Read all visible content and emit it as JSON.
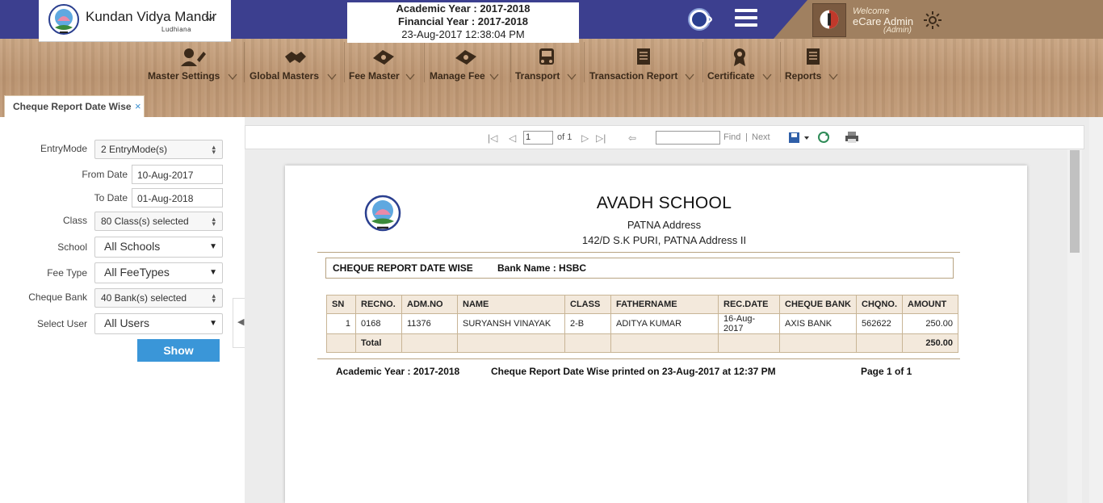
{
  "header": {
    "school_name": "Kundan Vidya Mandir",
    "school_city": "Ludhiana",
    "academic_year": "Academic Year : 2017-2018",
    "financial_year": "Financial Year : 2017-2018",
    "datetime": "23-Aug-2017 12:38:04 PM",
    "welcome": "Welcome",
    "user_name": "eCare Admin",
    "user_role": "(Admin)",
    "colors": {
      "topbar": "#3c3f8f",
      "accent": "#3a96d8"
    }
  },
  "menu": [
    {
      "label": "Master Settings",
      "icon": "user-edit-icon"
    },
    {
      "label": "Global Masters",
      "icon": "handshake-icon"
    },
    {
      "label": "Fee Master",
      "icon": "money-icon"
    },
    {
      "label": "Manage Fee",
      "icon": "money-icon"
    },
    {
      "label": "Transport",
      "icon": "bus-icon"
    },
    {
      "label": "Transaction Report",
      "icon": "document-icon"
    },
    {
      "label": "Certificate",
      "icon": "award-icon"
    },
    {
      "label": "Reports",
      "icon": "document-icon"
    }
  ],
  "tab": {
    "label": "Cheque Report Date Wise",
    "close": "×"
  },
  "form": {
    "entry_mode": {
      "label": "EntryMode",
      "value": "2 EntryMode(s)"
    },
    "from_date": {
      "label": "From Date",
      "value": "10-Aug-2017"
    },
    "to_date": {
      "label": "To Date",
      "value": "01-Aug-2018"
    },
    "class": {
      "label": "Class",
      "value": "80 Class(s) selected"
    },
    "school": {
      "label": "School",
      "value": "All Schools"
    },
    "fee_type": {
      "label": "Fee Type",
      "value": "All FeeTypes"
    },
    "cheque_bank": {
      "label": "Cheque Bank",
      "value": "40 Bank(s) selected"
    },
    "select_user": {
      "label": "Select User",
      "value": "All Users"
    },
    "show_button": "Show"
  },
  "toolbar": {
    "page_value": "1",
    "of_pages": "of 1",
    "find": "Find",
    "separator": "|",
    "next": "Next"
  },
  "report": {
    "school": "AVADH SCHOOL",
    "address1": "PATNA Address",
    "address2": "142/D S.K PURI, PATNA Address II",
    "title": "CHEQUE REPORT DATE WISE",
    "bank": "Bank Name : HSBC",
    "columns": [
      "SN",
      "RECNO.",
      "ADM.NO",
      "NAME",
      "CLASS",
      "FATHERNAME",
      "REC.DATE",
      "CHEQUE BANK",
      "CHQNO.",
      "AMOUNT"
    ],
    "rows": [
      [
        "1",
        "0168",
        "11376",
        "SURYANSH VINAYAK",
        "2-B",
        "ADITYA KUMAR",
        "16-Aug-2017",
        "AXIS BANK",
        "562622",
        "250.00"
      ]
    ],
    "total_label": "Total",
    "total_amount": "250.00",
    "footer_year": "Academic Year : 2017-2018",
    "footer_printed": "Cheque Report Date Wise  printed on 23-Aug-2017 at 12:37 PM",
    "footer_page": "Page 1 of 1"
  }
}
